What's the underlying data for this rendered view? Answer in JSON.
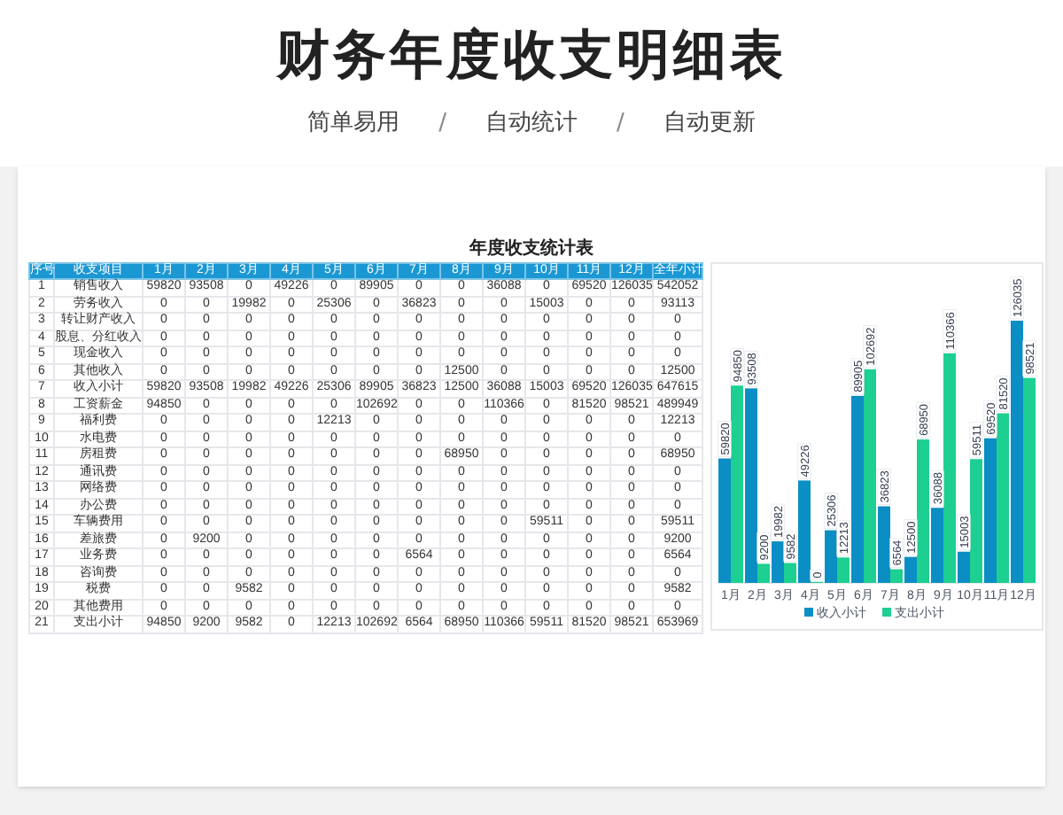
{
  "title": "财务年度收支明细表",
  "features": [
    "简单易用",
    "自动统计",
    "自动更新"
  ],
  "separator": "/",
  "sheet": {
    "title": "年度收支统计表",
    "columns": [
      "序号",
      "收支项目",
      "1月",
      "2月",
      "3月",
      "4月",
      "5月",
      "6月",
      "7月",
      "8月",
      "9月",
      "10月",
      "11月",
      "12月",
      "全年小计"
    ],
    "rows": [
      [
        "1",
        "销售收入",
        "59820",
        "93508",
        "0",
        "49226",
        "0",
        "89905",
        "0",
        "0",
        "36088",
        "0",
        "69520",
        "126035",
        "542052"
      ],
      [
        "2",
        "劳务收入",
        "0",
        "0",
        "19982",
        "0",
        "25306",
        "0",
        "36823",
        "0",
        "0",
        "15003",
        "0",
        "0",
        "93113"
      ],
      [
        "3",
        "转让财产收入",
        "0",
        "0",
        "0",
        "0",
        "0",
        "0",
        "0",
        "0",
        "0",
        "0",
        "0",
        "0",
        "0"
      ],
      [
        "4",
        "股息、分红收入",
        "0",
        "0",
        "0",
        "0",
        "0",
        "0",
        "0",
        "0",
        "0",
        "0",
        "0",
        "0",
        "0"
      ],
      [
        "5",
        "现金收入",
        "0",
        "0",
        "0",
        "0",
        "0",
        "0",
        "0",
        "0",
        "0",
        "0",
        "0",
        "0",
        "0"
      ],
      [
        "6",
        "其他收入",
        "0",
        "0",
        "0",
        "0",
        "0",
        "0",
        "0",
        "12500",
        "0",
        "0",
        "0",
        "0",
        "12500"
      ],
      [
        "7",
        "收入小计",
        "59820",
        "93508",
        "19982",
        "49226",
        "25306",
        "89905",
        "36823",
        "12500",
        "36088",
        "15003",
        "69520",
        "126035",
        "647615"
      ],
      [
        "8",
        "工资薪金",
        "94850",
        "0",
        "0",
        "0",
        "0",
        "102692",
        "0",
        "0",
        "110366",
        "0",
        "81520",
        "98521",
        "489949"
      ],
      [
        "9",
        "福利费",
        "0",
        "0",
        "0",
        "0",
        "12213",
        "0",
        "0",
        "0",
        "0",
        "0",
        "0",
        "0",
        "12213"
      ],
      [
        "10",
        "水电费",
        "0",
        "0",
        "0",
        "0",
        "0",
        "0",
        "0",
        "0",
        "0",
        "0",
        "0",
        "0",
        "0"
      ],
      [
        "11",
        "房租费",
        "0",
        "0",
        "0",
        "0",
        "0",
        "0",
        "0",
        "68950",
        "0",
        "0",
        "0",
        "0",
        "68950"
      ],
      [
        "12",
        "通讯费",
        "0",
        "0",
        "0",
        "0",
        "0",
        "0",
        "0",
        "0",
        "0",
        "0",
        "0",
        "0",
        "0"
      ],
      [
        "13",
        "网络费",
        "0",
        "0",
        "0",
        "0",
        "0",
        "0",
        "0",
        "0",
        "0",
        "0",
        "0",
        "0",
        "0"
      ],
      [
        "14",
        "办公费",
        "0",
        "0",
        "0",
        "0",
        "0",
        "0",
        "0",
        "0",
        "0",
        "0",
        "0",
        "0",
        "0"
      ],
      [
        "15",
        "车辆费用",
        "0",
        "0",
        "0",
        "0",
        "0",
        "0",
        "0",
        "0",
        "0",
        "59511",
        "0",
        "0",
        "59511"
      ],
      [
        "16",
        "差旅费",
        "0",
        "9200",
        "0",
        "0",
        "0",
        "0",
        "0",
        "0",
        "0",
        "0",
        "0",
        "0",
        "9200"
      ],
      [
        "17",
        "业务费",
        "0",
        "0",
        "0",
        "0",
        "0",
        "0",
        "6564",
        "0",
        "0",
        "0",
        "0",
        "0",
        "6564"
      ],
      [
        "18",
        "咨询费",
        "0",
        "0",
        "0",
        "0",
        "0",
        "0",
        "0",
        "0",
        "0",
        "0",
        "0",
        "0",
        "0"
      ],
      [
        "19",
        "税费",
        "0",
        "0",
        "9582",
        "0",
        "0",
        "0",
        "0",
        "0",
        "0",
        "0",
        "0",
        "0",
        "9582"
      ],
      [
        "20",
        "其他费用",
        "0",
        "0",
        "0",
        "0",
        "0",
        "0",
        "0",
        "0",
        "0",
        "0",
        "0",
        "0",
        "0"
      ],
      [
        "21",
        "支出小计",
        "94850",
        "9200",
        "9582",
        "0",
        "12213",
        "102692",
        "6564",
        "68950",
        "110366",
        "59511",
        "81520",
        "98521",
        "653969"
      ]
    ],
    "chart_data": {
      "type": "bar",
      "categories": [
        "1月",
        "2月",
        "3月",
        "4月",
        "5月",
        "6月",
        "7月",
        "8月",
        "9月",
        "10月",
        "11月",
        "12月"
      ],
      "series": [
        {
          "name": "收入小计",
          "color": "#0b8ec3",
          "values": [
            59820,
            93508,
            19982,
            49226,
            25306,
            89905,
            36823,
            12500,
            36088,
            15003,
            69520,
            126035
          ]
        },
        {
          "name": "支出小计",
          "color": "#1dcf91",
          "values": [
            94850,
            9200,
            9582,
            0,
            12213,
            102692,
            6564,
            68950,
            110366,
            59511,
            81520,
            98521
          ]
        }
      ],
      "data_labels": true,
      "legend": "bottom"
    }
  }
}
